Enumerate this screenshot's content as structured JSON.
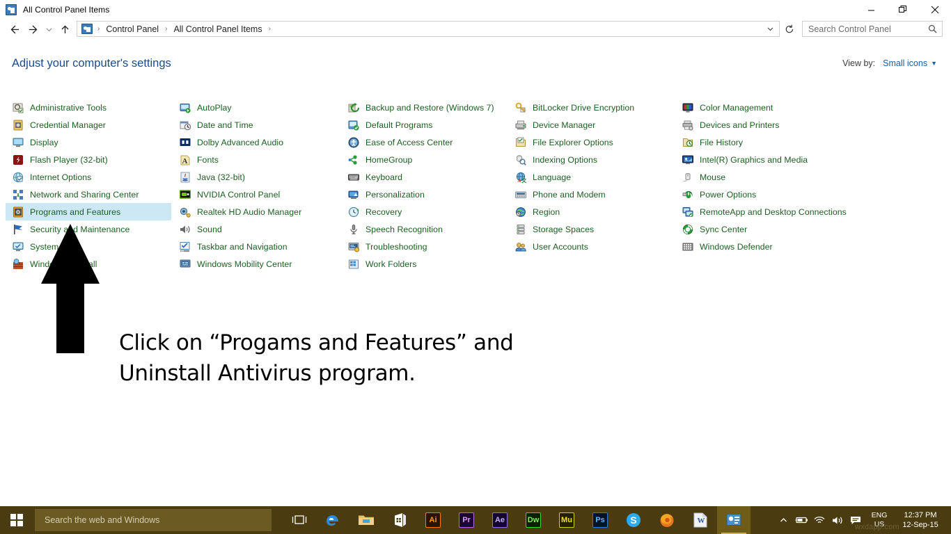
{
  "window": {
    "title": "All Control Panel Items",
    "icon": "control-panel-icon",
    "controls": {
      "minimize": "Minimize",
      "restore": "Restore",
      "close": "Close"
    }
  },
  "nav": {
    "back": "Back",
    "forward": "Forward",
    "recent": "Recent locations",
    "up": "Up",
    "refresh": "Refresh",
    "breadcrumb": [
      "Control Panel",
      "All Control Panel Items"
    ],
    "separator": "›"
  },
  "search": {
    "placeholder": "Search Control Panel",
    "icon": "search-icon"
  },
  "header": {
    "page_title": "Adjust your computer's settings",
    "view_by_label": "View by:",
    "view_by_value": "Small icons",
    "caret": "▼"
  },
  "colors": {
    "link": "#1b5e20",
    "heading": "#1a4b8c",
    "accent": "#1a5fa8",
    "selection": "#cce8f4",
    "taskbar": "#4a3c10"
  },
  "columns": [
    {
      "items": [
        {
          "label": "Administrative Tools",
          "icon": "administrative-tools-icon",
          "selected": false
        },
        {
          "label": "Credential Manager",
          "icon": "credential-manager-icon",
          "selected": false
        },
        {
          "label": "Display",
          "icon": "display-icon",
          "selected": false
        },
        {
          "label": "Flash Player (32-bit)",
          "icon": "flash-player-icon",
          "selected": false
        },
        {
          "label": "Internet Options",
          "icon": "internet-options-icon",
          "selected": false
        },
        {
          "label": "Network and Sharing Center",
          "icon": "network-sharing-icon",
          "selected": false
        },
        {
          "label": "Programs and Features",
          "icon": "programs-features-icon",
          "selected": true
        },
        {
          "label": "Security and Maintenance",
          "icon": "security-maintenance-icon",
          "selected": false
        },
        {
          "label": "System",
          "icon": "system-icon",
          "selected": false
        },
        {
          "label": "Windows Firewall",
          "icon": "windows-firewall-icon",
          "selected": false
        }
      ]
    },
    {
      "items": [
        {
          "label": "AutoPlay",
          "icon": "autoplay-icon",
          "selected": false
        },
        {
          "label": "Date and Time",
          "icon": "date-time-icon",
          "selected": false
        },
        {
          "label": "Dolby Advanced Audio",
          "icon": "dolby-audio-icon",
          "selected": false
        },
        {
          "label": "Fonts",
          "icon": "fonts-icon",
          "selected": false
        },
        {
          "label": "Java (32-bit)",
          "icon": "java-icon",
          "selected": false
        },
        {
          "label": "NVIDIA Control Panel",
          "icon": "nvidia-icon",
          "selected": false
        },
        {
          "label": "Realtek HD Audio Manager",
          "icon": "realtek-audio-icon",
          "selected": false
        },
        {
          "label": "Sound",
          "icon": "sound-icon",
          "selected": false
        },
        {
          "label": "Taskbar and Navigation",
          "icon": "taskbar-navigation-icon",
          "selected": false
        },
        {
          "label": "Windows Mobility Center",
          "icon": "mobility-center-icon",
          "selected": false
        }
      ]
    },
    {
      "items": [
        {
          "label": "Backup and Restore (Windows 7)",
          "icon": "backup-restore-icon",
          "selected": false
        },
        {
          "label": "Default Programs",
          "icon": "default-programs-icon",
          "selected": false
        },
        {
          "label": "Ease of Access Center",
          "icon": "ease-of-access-icon",
          "selected": false
        },
        {
          "label": "HomeGroup",
          "icon": "homegroup-icon",
          "selected": false
        },
        {
          "label": "Keyboard",
          "icon": "keyboard-icon",
          "selected": false
        },
        {
          "label": "Personalization",
          "icon": "personalization-icon",
          "selected": false
        },
        {
          "label": "Recovery",
          "icon": "recovery-icon",
          "selected": false
        },
        {
          "label": "Speech Recognition",
          "icon": "speech-recognition-icon",
          "selected": false
        },
        {
          "label": "Troubleshooting",
          "icon": "troubleshooting-icon",
          "selected": false
        },
        {
          "label": "Work Folders",
          "icon": "work-folders-icon",
          "selected": false
        }
      ]
    },
    {
      "items": [
        {
          "label": "BitLocker Drive Encryption",
          "icon": "bitlocker-icon",
          "selected": false
        },
        {
          "label": "Device Manager",
          "icon": "device-manager-icon",
          "selected": false
        },
        {
          "label": "File Explorer Options",
          "icon": "file-explorer-options-icon",
          "selected": false
        },
        {
          "label": "Indexing Options",
          "icon": "indexing-options-icon",
          "selected": false
        },
        {
          "label": "Language",
          "icon": "language-icon",
          "selected": false
        },
        {
          "label": "Phone and Modem",
          "icon": "phone-modem-icon",
          "selected": false
        },
        {
          "label": "Region",
          "icon": "region-icon",
          "selected": false
        },
        {
          "label": "Storage Spaces",
          "icon": "storage-spaces-icon",
          "selected": false
        },
        {
          "label": "User Accounts",
          "icon": "user-accounts-icon",
          "selected": false
        }
      ]
    },
    {
      "items": [
        {
          "label": "Color Management",
          "icon": "color-management-icon",
          "selected": false
        },
        {
          "label": "Devices and Printers",
          "icon": "devices-printers-icon",
          "selected": false
        },
        {
          "label": "File History",
          "icon": "file-history-icon",
          "selected": false
        },
        {
          "label": "Intel(R) Graphics and Media",
          "icon": "intel-graphics-icon",
          "selected": false
        },
        {
          "label": "Mouse",
          "icon": "mouse-icon",
          "selected": false
        },
        {
          "label": "Power Options",
          "icon": "power-options-icon",
          "selected": false
        },
        {
          "label": "RemoteApp and Desktop Connections",
          "icon": "remoteapp-icon",
          "selected": false
        },
        {
          "label": "Sync Center",
          "icon": "sync-center-icon",
          "selected": false
        },
        {
          "label": "Windows Defender",
          "icon": "windows-defender-icon",
          "selected": false
        }
      ]
    }
  ],
  "annotation": {
    "line1": "Click on “Progams and Features” and",
    "line2": "Uninstall Antivirus program.",
    "arrow": "up-arrow-annotation"
  },
  "taskbar": {
    "start": "start-button",
    "search_placeholder": "Search the web and Windows",
    "task_view": "task-view-button",
    "apps": [
      {
        "name": "edge",
        "label": "e"
      },
      {
        "name": "file-explorer",
        "label": ""
      },
      {
        "name": "store",
        "label": ""
      },
      {
        "name": "illustrator",
        "label": "Ai"
      },
      {
        "name": "premiere-pro",
        "label": "Pr"
      },
      {
        "name": "after-effects",
        "label": "Ae"
      },
      {
        "name": "dreamweaver",
        "label": "Dw"
      },
      {
        "name": "muse",
        "label": "Mu"
      },
      {
        "name": "photoshop",
        "label": "Ps"
      },
      {
        "name": "skype",
        "label": "S"
      },
      {
        "name": "firefox",
        "label": ""
      },
      {
        "name": "word",
        "label": "W"
      },
      {
        "name": "control-panel",
        "label": ""
      }
    ],
    "tray": {
      "show_hidden": "show-hidden-icons",
      "battery": "battery-icon",
      "network": "wifi-icon",
      "volume": "volume-icon",
      "action_center": "action-center-icon",
      "lang_line1": "ENG",
      "lang_line2": "US",
      "time": "12:37 PM",
      "date": "12-Sep-15"
    },
    "watermark": "wxdapp.com"
  }
}
